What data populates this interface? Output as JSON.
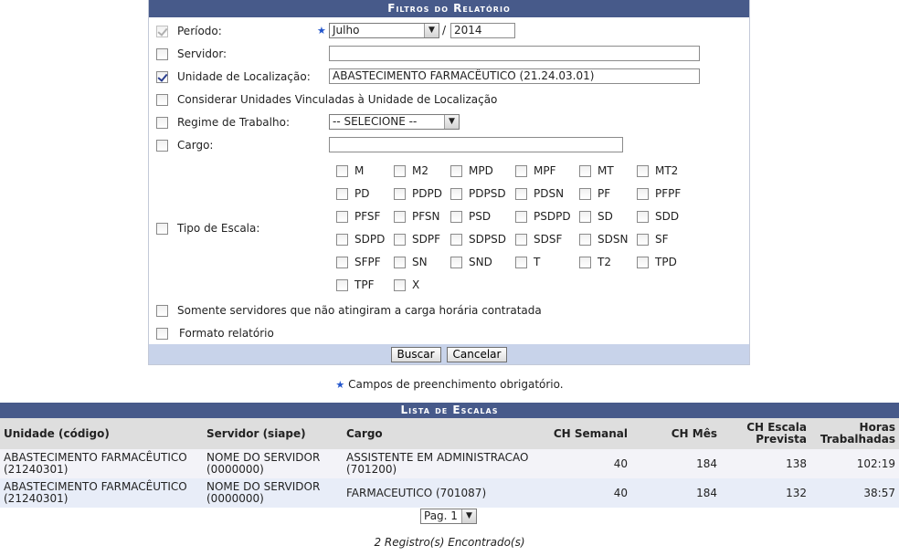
{
  "filters": {
    "title": "Filtros do Relatório",
    "periodo": {
      "label": "Período:",
      "month": "Julho",
      "separator": "/",
      "year": "2014",
      "required_mark": "★"
    },
    "servidor": {
      "label": "Servidor:",
      "value": ""
    },
    "unidade": {
      "label": "Unidade de Localização:",
      "value": "ABASTECIMENTO FARMACÊUTICO (21.24.03.01)"
    },
    "vinculadas": {
      "label": "Considerar Unidades Vinculadas à Unidade de Localização"
    },
    "regime": {
      "label": "Regime de Trabalho:",
      "value": "-- SELECIONE --"
    },
    "cargo": {
      "label": "Cargo:",
      "value": ""
    },
    "tipo_escala": {
      "label": "Tipo de Escala:",
      "options": [
        "M",
        "M2",
        "MPD",
        "MPF",
        "MT",
        "MT2",
        "PD",
        "PDPD",
        "PDPSD",
        "PDSN",
        "PF",
        "PFPF",
        "PFSF",
        "PFSN",
        "PSD",
        "PSDPD",
        "SD",
        "SDD",
        "SDPD",
        "SDPF",
        "SDPSD",
        "SDSF",
        "SDSN",
        "SF",
        "SFPF",
        "SN",
        "SND",
        "T",
        "T2",
        "TPD",
        "TPF",
        "X"
      ]
    },
    "somente": {
      "label": "Somente servidores que não atingiram a carga horária contratada"
    },
    "formato": {
      "label": "Formato relatório"
    },
    "buttons": {
      "buscar": "Buscar",
      "cancelar": "Cancelar"
    }
  },
  "note": {
    "star": "★",
    "text": "Campos de preenchimento obrigatório."
  },
  "list": {
    "title": "Lista de Escalas",
    "headers": {
      "unidade": "Unidade (código)",
      "servidor": "Servidor (siape)",
      "cargo": "Cargo",
      "ch_semanal": "CH Semanal",
      "ch_mes": "CH Mês",
      "ch_escala_1": "CH Escala",
      "ch_escala_2": "Prevista",
      "horas_1": "Horas",
      "horas_2": "Trabalhadas"
    },
    "rows": [
      {
        "unidade_1": "ABASTECIMENTO FARMACÊUTICO",
        "unidade_2": "(21240301)",
        "servidor_1": "NOME DO SERVIDOR",
        "servidor_2": "(0000000)",
        "cargo_1": "ASSISTENTE EM ADMINISTRACAO",
        "cargo_2": "(701200)",
        "ch_semanal": "40",
        "ch_mes": "184",
        "ch_escala": "138",
        "horas": "102:19"
      },
      {
        "unidade_1": "ABASTECIMENTO FARMACÊUTICO",
        "unidade_2": "(21240301)",
        "servidor_1": "NOME DO SERVIDOR",
        "servidor_2": "(0000000)",
        "cargo_1": "FARMACEUTICO (701087)",
        "cargo_2": "",
        "ch_semanal": "40",
        "ch_mes": "184",
        "ch_escala": "132",
        "horas": "38:57"
      }
    ],
    "page": "Pag. 1",
    "records": "2 Registro(s) Encontrado(s)"
  }
}
